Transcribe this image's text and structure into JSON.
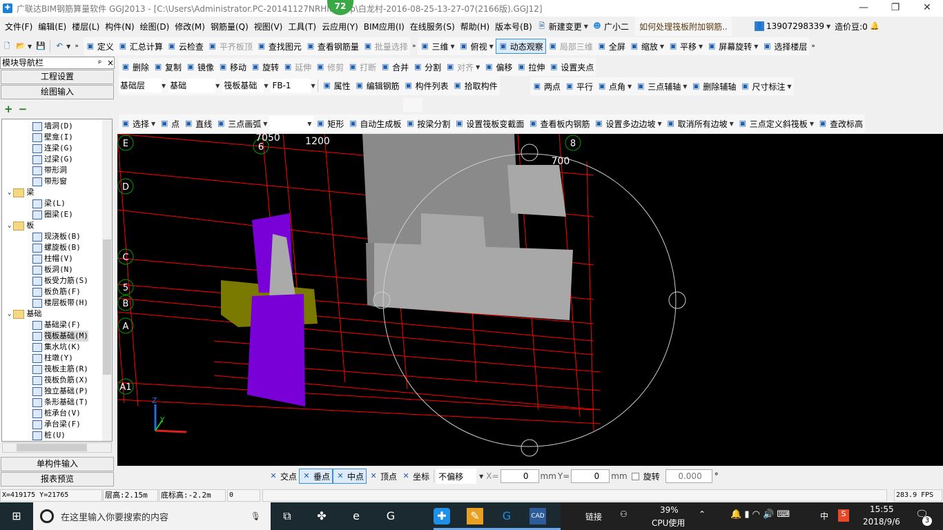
{
  "window": {
    "title": "广联达BIM钢筋算量软件 GGJ2013 - [C:\\Users\\Administrator.PC-20141127NRHI...ktop\\白龙村-2016-08-25-13-27-07(2166版).GGJ12]",
    "badge": "72",
    "minimize": "—",
    "restore": "❐",
    "close": "✕"
  },
  "menu": [
    "文件(F)",
    "编辑(E)",
    "楼层(L)",
    "构件(N)",
    "绘图(D)",
    "修改(M)",
    "钢筋量(Q)",
    "视图(V)",
    "工具(T)",
    "云应用(Y)",
    "BIM应用(I)",
    "在线服务(S)",
    "帮助(H)",
    "版本号(B)"
  ],
  "menu_right": {
    "new_change": "新建变更",
    "assistant": "广小二",
    "question": "如何处理筏板附加钢筋..",
    "phone": "13907298339",
    "beans": "造价豆:0"
  },
  "toolbar1": [
    {
      "label": "定义",
      "icon": "define-icon"
    },
    {
      "label": "汇总计算",
      "icon": "sigma-icon"
    },
    {
      "label": "云检查",
      "icon": "cloud-check-icon"
    },
    {
      "label": "平齐板顶",
      "icon": "align-slab-icon",
      "disabled": true
    },
    {
      "label": "查找图元",
      "icon": "binoculars-icon"
    },
    {
      "label": "查看钢筋量",
      "icon": "glasses-icon"
    },
    {
      "label": "批量选择",
      "icon": "batch-select-icon",
      "disabled": true
    }
  ],
  "toolbar1b": [
    {
      "label": "三维",
      "icon": "cube-icon",
      "dd": true
    },
    {
      "label": "俯视",
      "icon": "top-view-icon",
      "dd": true
    },
    {
      "label": "动态观察",
      "icon": "orbit-icon",
      "active": true
    },
    {
      "label": "局部三维",
      "icon": "local-3d-icon",
      "disabled": true
    },
    {
      "label": "全屏",
      "icon": "fullscreen-icon"
    },
    {
      "label": "缩放",
      "icon": "zoom-icon",
      "dd": true
    },
    {
      "label": "平移",
      "icon": "pan-icon",
      "dd": true
    },
    {
      "label": "屏幕旋转",
      "icon": "rotate-screen-icon",
      "dd": true
    },
    {
      "label": "选择楼层",
      "icon": "select-floor-icon"
    }
  ],
  "toolbar2": [
    {
      "label": "删除",
      "icon": "delete-icon"
    },
    {
      "label": "复制",
      "icon": "copy-icon"
    },
    {
      "label": "镜像",
      "icon": "mirror-icon"
    },
    {
      "label": "移动",
      "icon": "move-icon"
    },
    {
      "label": "旋转",
      "icon": "rotate-icon"
    },
    {
      "label": "延伸",
      "icon": "extend-icon",
      "disabled": true
    },
    {
      "label": "修剪",
      "icon": "trim-icon",
      "disabled": true
    },
    {
      "label": "打断",
      "icon": "break-icon",
      "disabled": true
    },
    {
      "label": "合并",
      "icon": "merge-icon"
    },
    {
      "label": "分割",
      "icon": "split-icon"
    },
    {
      "label": "对齐",
      "icon": "align-icon",
      "disabled": true,
      "dd": true
    },
    {
      "label": "偏移",
      "icon": "offset-icon"
    },
    {
      "label": "拉伸",
      "icon": "stretch-icon"
    },
    {
      "label": "设置夹点",
      "icon": "grip-icon"
    }
  ],
  "selectors": {
    "floor": "基础层",
    "category": "基础",
    "type": "筏板基础",
    "name": "FB-1"
  },
  "toolbar3": [
    {
      "label": "属性",
      "icon": "properties-icon"
    },
    {
      "label": "编辑钢筋",
      "icon": "edit-rebar-icon"
    },
    {
      "label": "构件列表",
      "icon": "component-list-icon"
    },
    {
      "label": "拾取构件",
      "icon": "pick-icon"
    }
  ],
  "toolbar3b": [
    {
      "label": "两点",
      "icon": "two-point-icon"
    },
    {
      "label": "平行",
      "icon": "parallel-icon"
    },
    {
      "label": "点角",
      "icon": "point-angle-icon",
      "dd": true
    },
    {
      "label": "三点辅轴",
      "icon": "three-point-axis-icon",
      "dd": true
    },
    {
      "label": "删除辅轴",
      "icon": "delete-axis-icon"
    },
    {
      "label": "尺寸标注",
      "icon": "dimension-icon",
      "dd": true
    }
  ],
  "toolbar4": [
    {
      "label": "选择",
      "icon": "cursor-icon",
      "dd": true
    },
    {
      "label": "点",
      "icon": "point-icon"
    },
    {
      "label": "直线",
      "icon": "line-icon"
    },
    {
      "label": "三点画弧",
      "icon": "arc-icon",
      "dd": true
    },
    {
      "label": "",
      "icon": "",
      "combo": true
    },
    {
      "label": "矩形",
      "icon": "rectangle-icon"
    },
    {
      "label": "自动生成板",
      "icon": "auto-slab-icon"
    },
    {
      "label": "按梁分割",
      "icon": "split-by-beam-icon"
    },
    {
      "label": "设置筏板变截面",
      "icon": "variable-section-icon"
    },
    {
      "label": "查看板内钢筋",
      "icon": "view-slab-rebar-icon"
    },
    {
      "label": "设置多边边坡",
      "icon": "slope-icon",
      "dd": true
    },
    {
      "label": "取消所有边坡",
      "icon": "cancel-slope-icon",
      "dd": true
    },
    {
      "label": "三点定义斜筏板",
      "icon": "sloped-raft-icon",
      "dd": true
    },
    {
      "label": "查改标高",
      "icon": "elevation-icon"
    }
  ],
  "left_panel": {
    "title": "模块导航栏",
    "pin": "ᵖ",
    "close": "×",
    "project_settings": "工程设置",
    "drawing_input": "绘图输入",
    "expand": "+",
    "collapse": "−",
    "single_input": "单构件输入",
    "report_preview": "报表预览"
  },
  "tree": [
    {
      "label": "墙洞(D)"
    },
    {
      "label": "壁龛(I)"
    },
    {
      "label": "连梁(G)"
    },
    {
      "label": "过梁(G)"
    },
    {
      "label": "带形洞"
    },
    {
      "label": "带形窗"
    },
    {
      "label": "梁",
      "folder": true
    },
    {
      "label": "梁(L)"
    },
    {
      "label": "圈梁(E)"
    },
    {
      "label": "板",
      "folder": true
    },
    {
      "label": "现浇板(B)"
    },
    {
      "label": "螺旋板(B)"
    },
    {
      "label": "柱帽(V)"
    },
    {
      "label": "板洞(N)"
    },
    {
      "label": "板受力筋(S)"
    },
    {
      "label": "板负筋(F)"
    },
    {
      "label": "楼层板带(H)"
    },
    {
      "label": "基础",
      "folder": true
    },
    {
      "label": "基础梁(F)"
    },
    {
      "label": "筏板基础(M)",
      "selected": true
    },
    {
      "label": "集水坑(K)"
    },
    {
      "label": "柱墩(Y)"
    },
    {
      "label": "筏板主筋(R)"
    },
    {
      "label": "筏板负筋(X)"
    },
    {
      "label": "独立基础(P)"
    },
    {
      "label": "条形基础(T)"
    },
    {
      "label": "桩承台(V)"
    },
    {
      "label": "承台梁(F)"
    },
    {
      "label": "桩(U)"
    }
  ],
  "viewport": {
    "axes": [
      "E",
      "D",
      "C",
      "5",
      "B",
      "A",
      "A1",
      "6",
      "8"
    ],
    "dims": [
      "1200",
      "700",
      "7050"
    ],
    "colors": {
      "grid": "#ff0000",
      "axis": "#00a000",
      "block": "#a8a8a8",
      "column": "#7a00d8",
      "footing": "#7a7a00"
    },
    "triad": {
      "z": "Z",
      "y": "Y"
    }
  },
  "snapbar": {
    "items": [
      {
        "label": "交点",
        "icon": "intersection-icon"
      },
      {
        "label": "垂点",
        "icon": "perpendicular-icon",
        "active": true
      },
      {
        "label": "中点",
        "icon": "midpoint-icon",
        "active": true
      },
      {
        "label": "顶点",
        "icon": "vertex-icon"
      },
      {
        "label": "坐标",
        "icon": "coordinate-icon"
      }
    ],
    "offset_mode": "不偏移",
    "x_label": "X=",
    "x": "0",
    "y_label": "Y=",
    "y": "0",
    "unit": "mm",
    "rotate_label": "旋转",
    "rotate": "0.000",
    "deg": "°"
  },
  "status": {
    "coords": "X=419175 Y=21765",
    "floor_height": "层高:2.15m",
    "base_elev": "底标高:-2.2m",
    "value": "0",
    "fps": "283.9 FPS"
  },
  "taskbar": {
    "search": "在这里输入你要搜索的内容",
    "link": "链接",
    "cpu": "39%",
    "cpu_label": "CPU使用",
    "ime": "中",
    "time": "15:55",
    "date": "2018/9/6",
    "notifications": "3"
  }
}
